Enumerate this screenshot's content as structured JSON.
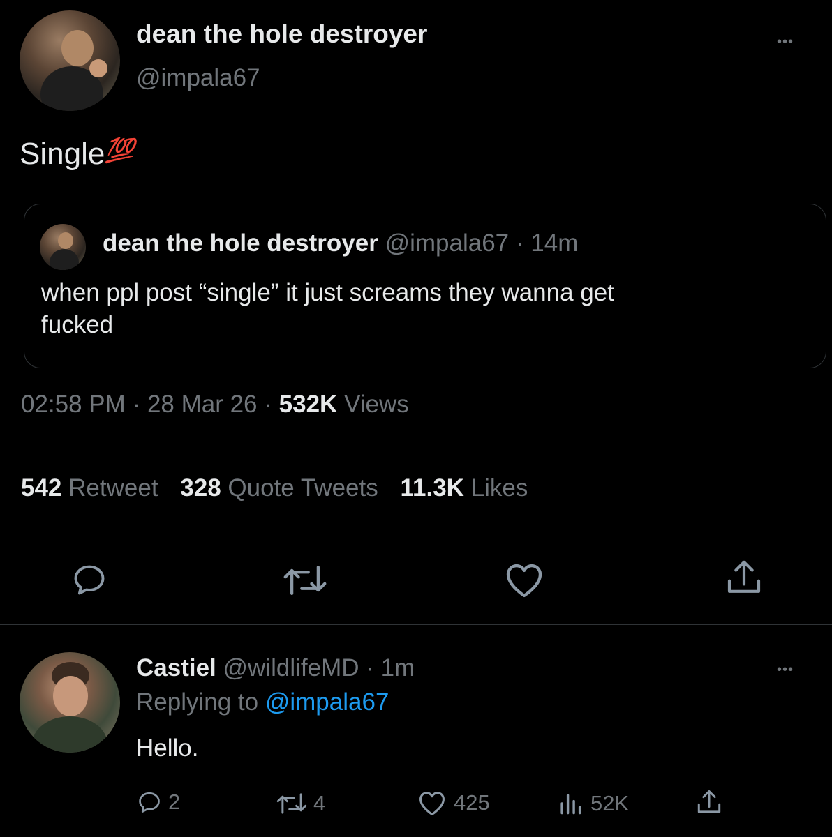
{
  "main_tweet": {
    "display_name": "dean the hole destroyer",
    "handle": "@impala67",
    "text": "Single",
    "emoji": "💯",
    "quoted": {
      "display_name": "dean the hole destroyer",
      "handle": "@impala67",
      "separator": "·",
      "time": "14m",
      "text_line1": "when ppl post “single” it just screams they wanna get",
      "text_line2": "fucked"
    },
    "meta": {
      "time": "02:58 PM",
      "sep1": "·",
      "date": "28 Mar 26",
      "sep2": "·",
      "views_count": "532K",
      "views_label": "Views"
    },
    "stats": {
      "retweets_count": "542",
      "retweets_label": "Retweet",
      "quotes_count": "328",
      "quotes_label": "Quote Tweets",
      "likes_count": "11.3K",
      "likes_label": "Likes"
    },
    "more_label": "•••"
  },
  "reply": {
    "display_name": "Castiel",
    "handle": "@wildlifeMD",
    "separator": "·",
    "time": "1m",
    "replying_prefix": "Replying to",
    "replying_handle": "@impala67",
    "text": "Hello.",
    "actions": {
      "replies": "2",
      "retweets": "4",
      "likes": "425",
      "views": "52K"
    },
    "more_label": "•••"
  },
  "colors": {
    "background": "#000000",
    "text": "#e7e9ea",
    "muted": "#71767b",
    "link": "#1d9bf0",
    "border": "#2f3336",
    "emoji": "#e0245e"
  },
  "icons": [
    "reply-icon",
    "retweet-icon",
    "like-icon",
    "share-icon",
    "views-icon",
    "more-icon"
  ]
}
